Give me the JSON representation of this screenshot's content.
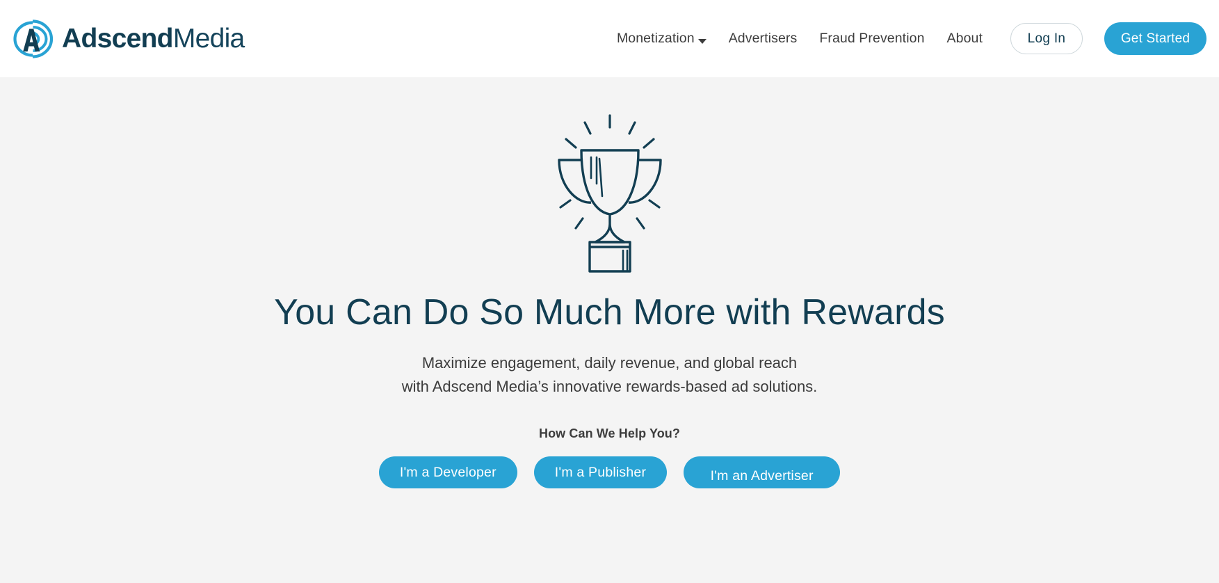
{
  "header": {
    "logo": {
      "icon": "adscend-signal-a-icon",
      "word_primary": "Adscend",
      "word_secondary": "Media"
    },
    "nav": [
      {
        "label": "Monetization",
        "has_dropdown": true
      },
      {
        "label": "Advertisers",
        "has_dropdown": false
      },
      {
        "label": "Fraud Prevention",
        "has_dropdown": false
      },
      {
        "label": "About",
        "has_dropdown": false
      }
    ],
    "login_label": "Log In",
    "get_started_label": "Get Started"
  },
  "hero": {
    "icon": "trophy-icon",
    "title": "You Can Do So Much More with Rewards",
    "subtitle_line1": "Maximize engagement, daily revenue, and global reach",
    "subtitle_line2": "with Adscend Media’s innovative rewards-based ad solutions.",
    "help_label": "How Can We Help You?",
    "cta_buttons": [
      {
        "label": "I'm a Developer"
      },
      {
        "label": "I'm a Publisher"
      },
      {
        "label": "I'm an Advertiser"
      }
    ]
  },
  "colors": {
    "brand_blue": "#29a3d4",
    "brand_navy": "#123e52",
    "body_text": "#3d3d3d",
    "page_background": "#f4f4f4",
    "header_background": "#ffffff"
  }
}
